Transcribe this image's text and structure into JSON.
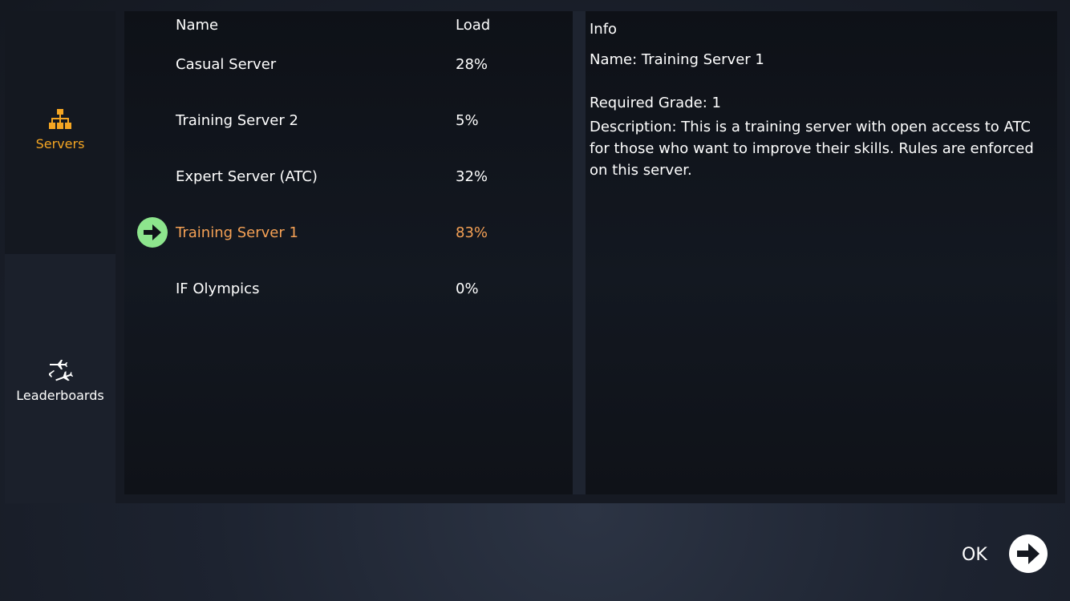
{
  "sidebar": {
    "servers": {
      "label": "Servers",
      "icon": "network-icon",
      "color": "#f5a623"
    },
    "leaderboards": {
      "label": "Leaderboards",
      "icon": "planes-icon"
    }
  },
  "list": {
    "headers": {
      "name": "Name",
      "load": "Load"
    },
    "rows": [
      {
        "name": "Casual Server",
        "load": "28%",
        "selected": false
      },
      {
        "name": "Training Server 2",
        "load": "5%",
        "selected": false
      },
      {
        "name": "Expert Server (ATC)",
        "load": "32%",
        "selected": false
      },
      {
        "name": "Training Server 1",
        "load": "83%",
        "selected": true
      },
      {
        "name": "IF Olympics",
        "load": "0%",
        "selected": false
      }
    ],
    "selected_color": "#f5a155",
    "selected_icon": "arrow-right-circle-icon",
    "selected_icon_color": "#8de58d"
  },
  "info": {
    "title": "Info",
    "name_line": "Name: Training Server 1",
    "grade_line": "Required Grade: 1",
    "description_line": "Description: This is a training server with open access to ATC for those who want to improve their skills. Rules are enforced on this server."
  },
  "footer": {
    "ok_label": "OK",
    "ok_icon": "arrow-right-circle-icon"
  }
}
